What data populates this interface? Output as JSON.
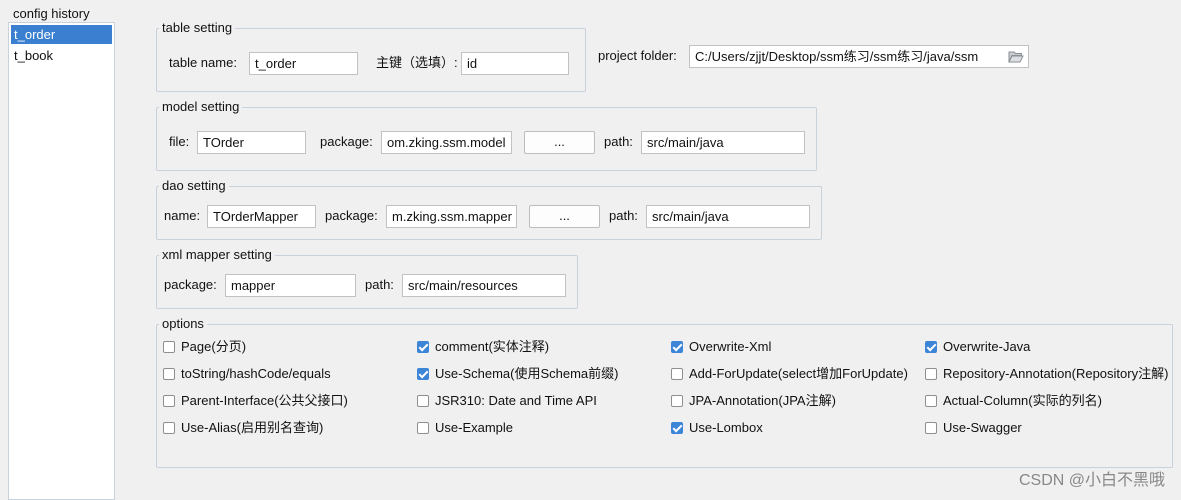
{
  "history": {
    "legend": "config history",
    "items": [
      {
        "label": "t_order",
        "selected": true
      },
      {
        "label": "t_book",
        "selected": false
      }
    ]
  },
  "table_setting": {
    "legend": "table setting",
    "name_label": "table  name:",
    "name_value": "t_order",
    "key_label": "主键（选填）:",
    "key_value": "id"
  },
  "project": {
    "label": "project folder:",
    "value": "C:/Users/zjjt/Desktop/ssm练习/ssm练习/java/ssm",
    "icon": "folder-open-icon"
  },
  "model_setting": {
    "legend": "model setting",
    "file_label": "file:",
    "file_value": "TOrder",
    "package_label": "package:",
    "package_value": "om.zking.ssm.model",
    "browse_label": "...",
    "path_label": "path:",
    "path_value": "src/main/java"
  },
  "dao_setting": {
    "legend": "dao setting",
    "name_label": "name:",
    "name_value": "TOrderMapper",
    "package_label": "package:",
    "package_value": "m.zking.ssm.mapper",
    "browse_label": "...",
    "path_label": "path:",
    "path_value": "src/main/java"
  },
  "xml_setting": {
    "legend": "xml mapper setting",
    "package_label": "package:",
    "package_value": "mapper",
    "path_label": "path:",
    "path_value": "src/main/resources"
  },
  "options": {
    "legend": "options",
    "items": [
      {
        "label": "Page(分页)",
        "checked": false
      },
      {
        "label": "comment(实体注释)",
        "checked": true
      },
      {
        "label": "Overwrite-Xml",
        "checked": true
      },
      {
        "label": "Overwrite-Java",
        "checked": true
      },
      {
        "label": "toString/hashCode/equals",
        "checked": false
      },
      {
        "label": "Use-Schema(使用Schema前缀)",
        "checked": true
      },
      {
        "label": "Add-ForUpdate(select增加ForUpdate)",
        "checked": false
      },
      {
        "label": "Repository-Annotation(Repository注解)",
        "checked": false
      },
      {
        "label": "Parent-Interface(公共父接口)",
        "checked": false
      },
      {
        "label": "JSR310: Date and Time API",
        "checked": false
      },
      {
        "label": "JPA-Annotation(JPA注解)",
        "checked": false
      },
      {
        "label": "Actual-Column(实际的列名)",
        "checked": false
      },
      {
        "label": "Use-Alias(启用别名查询)",
        "checked": false
      },
      {
        "label": "Use-Example",
        "checked": false
      },
      {
        "label": "Use-Lombox",
        "checked": true
      },
      {
        "label": "Use-Swagger",
        "checked": false
      }
    ]
  },
  "watermark": "CSDN @小白不黑哦",
  "colors": {
    "selection": "#3b7fd0",
    "checkbox_checked": "#3c85d7",
    "group_border": "#c8d2dc"
  }
}
